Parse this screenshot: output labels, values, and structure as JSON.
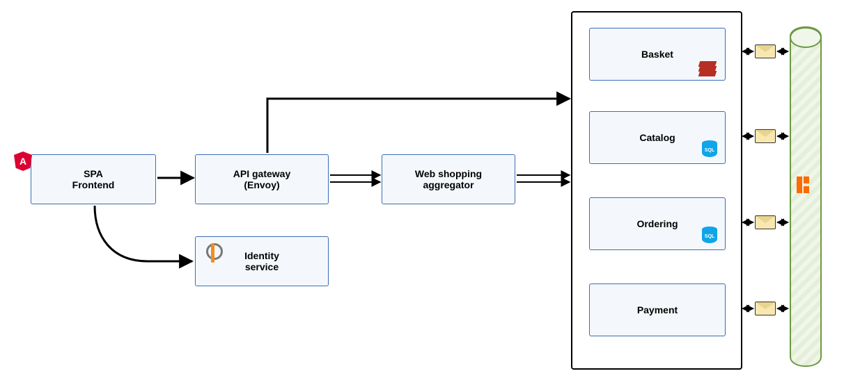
{
  "nodes": {
    "spa": "SPA\nFrontend",
    "gateway": "API gateway\n(Envoy)",
    "aggregator": "Web shopping\naggregator",
    "identity": "Identity\nservice",
    "basket": "Basket",
    "catalog": "Catalog",
    "ordering": "Ordering",
    "payment": "Payment"
  },
  "icons": {
    "angular": "A",
    "sql": "SQL"
  }
}
